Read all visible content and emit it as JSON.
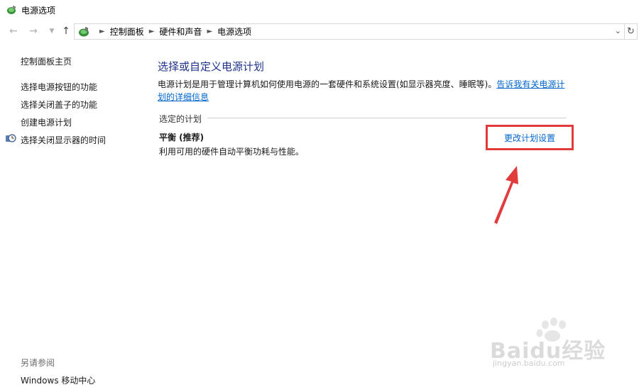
{
  "window": {
    "title": "电源选项",
    "icon": "power-options-icon"
  },
  "nav": {
    "back_icon": "back-arrow-icon",
    "forward_icon": "forward-arrow-icon",
    "history_icon": "chevron-down-icon",
    "up_icon": "up-arrow-icon",
    "breadcrumbs": [
      "控制面板",
      "硬件和声音",
      "电源选项"
    ],
    "refresh_icon": "refresh-icon"
  },
  "sidebar": {
    "home": "控制面板主页",
    "items": [
      "选择电源按钮的功能",
      "选择关闭盖子的功能",
      "创建电源计划",
      "选择关闭显示器的时间"
    ],
    "see_also": "另请参阅",
    "bottom_link": "Windows 移动中心"
  },
  "main": {
    "title": "选择或自定义电源计划",
    "description": "电源计划是用于管理计算机如何使用电源的一套硬件和系统设置(如显示器亮度、睡眠等)。",
    "learn_more_link": "告诉我有关电源计划的详细信息",
    "section_label": "选定的计划",
    "plan": {
      "name": "平衡 (推荐)",
      "description": "利用可用的硬件自动平衡功耗与性能。",
      "change_link": "更改计划设置"
    }
  },
  "annotation": {
    "highlight_color": "#e23b3b"
  },
  "watermark": {
    "text": "Baidu经验",
    "url": "jingyan.baidu.com"
  }
}
